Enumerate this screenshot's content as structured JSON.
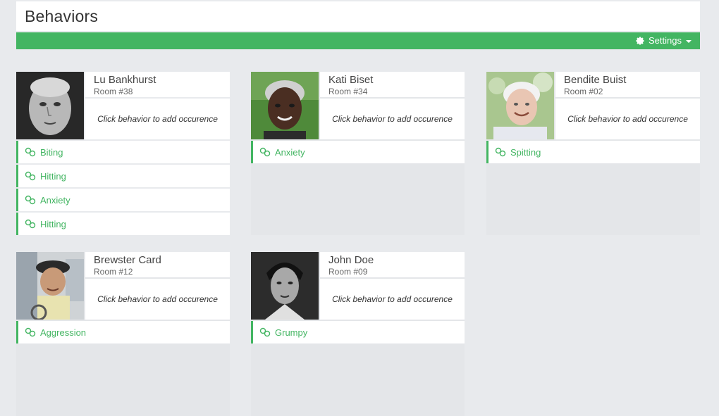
{
  "header": {
    "title": "Behaviors"
  },
  "toolbar": {
    "settings_label": "Settings"
  },
  "hint_text": "Click behavior to add occurence",
  "residents": [
    {
      "name": "Lu Bankhurst",
      "room": "Room #38",
      "behaviors": [
        "Biting",
        "Hitting",
        "Anxiety",
        "Hitting"
      ]
    },
    {
      "name": "Kati Biset",
      "room": "Room #34",
      "behaviors": [
        "Anxiety"
      ]
    },
    {
      "name": "Bendite Buist",
      "room": "Room #02",
      "behaviors": [
        "Spitting"
      ]
    },
    {
      "name": "Brewster Card",
      "room": "Room #12",
      "behaviors": [
        "Aggression"
      ]
    },
    {
      "name": "John Doe",
      "room": "Room #09",
      "behaviors": [
        "Grumpy"
      ]
    }
  ],
  "colors": {
    "accent": "#43b562",
    "background": "#e8eaed",
    "panel": "#ffffff"
  }
}
